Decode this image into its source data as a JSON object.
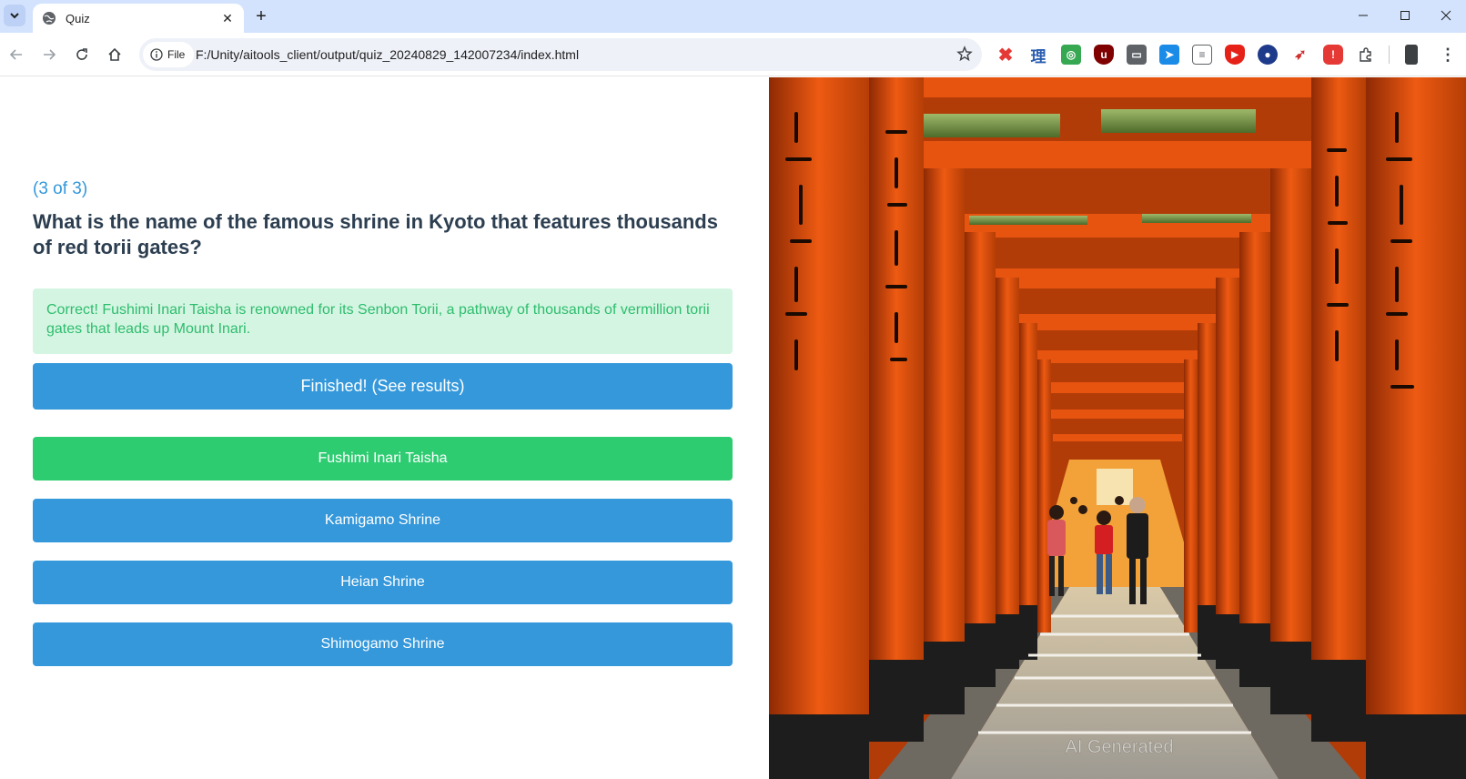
{
  "browser": {
    "tab_title": "Quiz",
    "file_label": "File",
    "url": "F:/Unity/aitools_client/output/quiz_20240829_142007234/index.html"
  },
  "quiz": {
    "progress": "(3 of 3)",
    "question": "What is the name of the famous shrine in Kyoto that features thousands of red torii gates?",
    "feedback": "Correct! Fushimi Inari Taisha is renowned for its Senbon Torii, a pathway of thousands of vermillion torii gates that leads up Mount Inari.",
    "finish_label": "Finished! (See results)",
    "answers": [
      "Fushimi Inari Taisha",
      "Kamigamo Shrine",
      "Heian Shrine",
      "Shimogamo Shrine"
    ],
    "correct_index": 0
  },
  "image": {
    "watermark": "AI Generated"
  },
  "colors": {
    "accent_blue": "#3498db",
    "correct_green": "#2ecc71",
    "feedback_bg": "#d4f5e2",
    "feedback_text": "#2ebd6d",
    "question_text": "#2c3e50",
    "torii_orange": "#ee5a12"
  }
}
